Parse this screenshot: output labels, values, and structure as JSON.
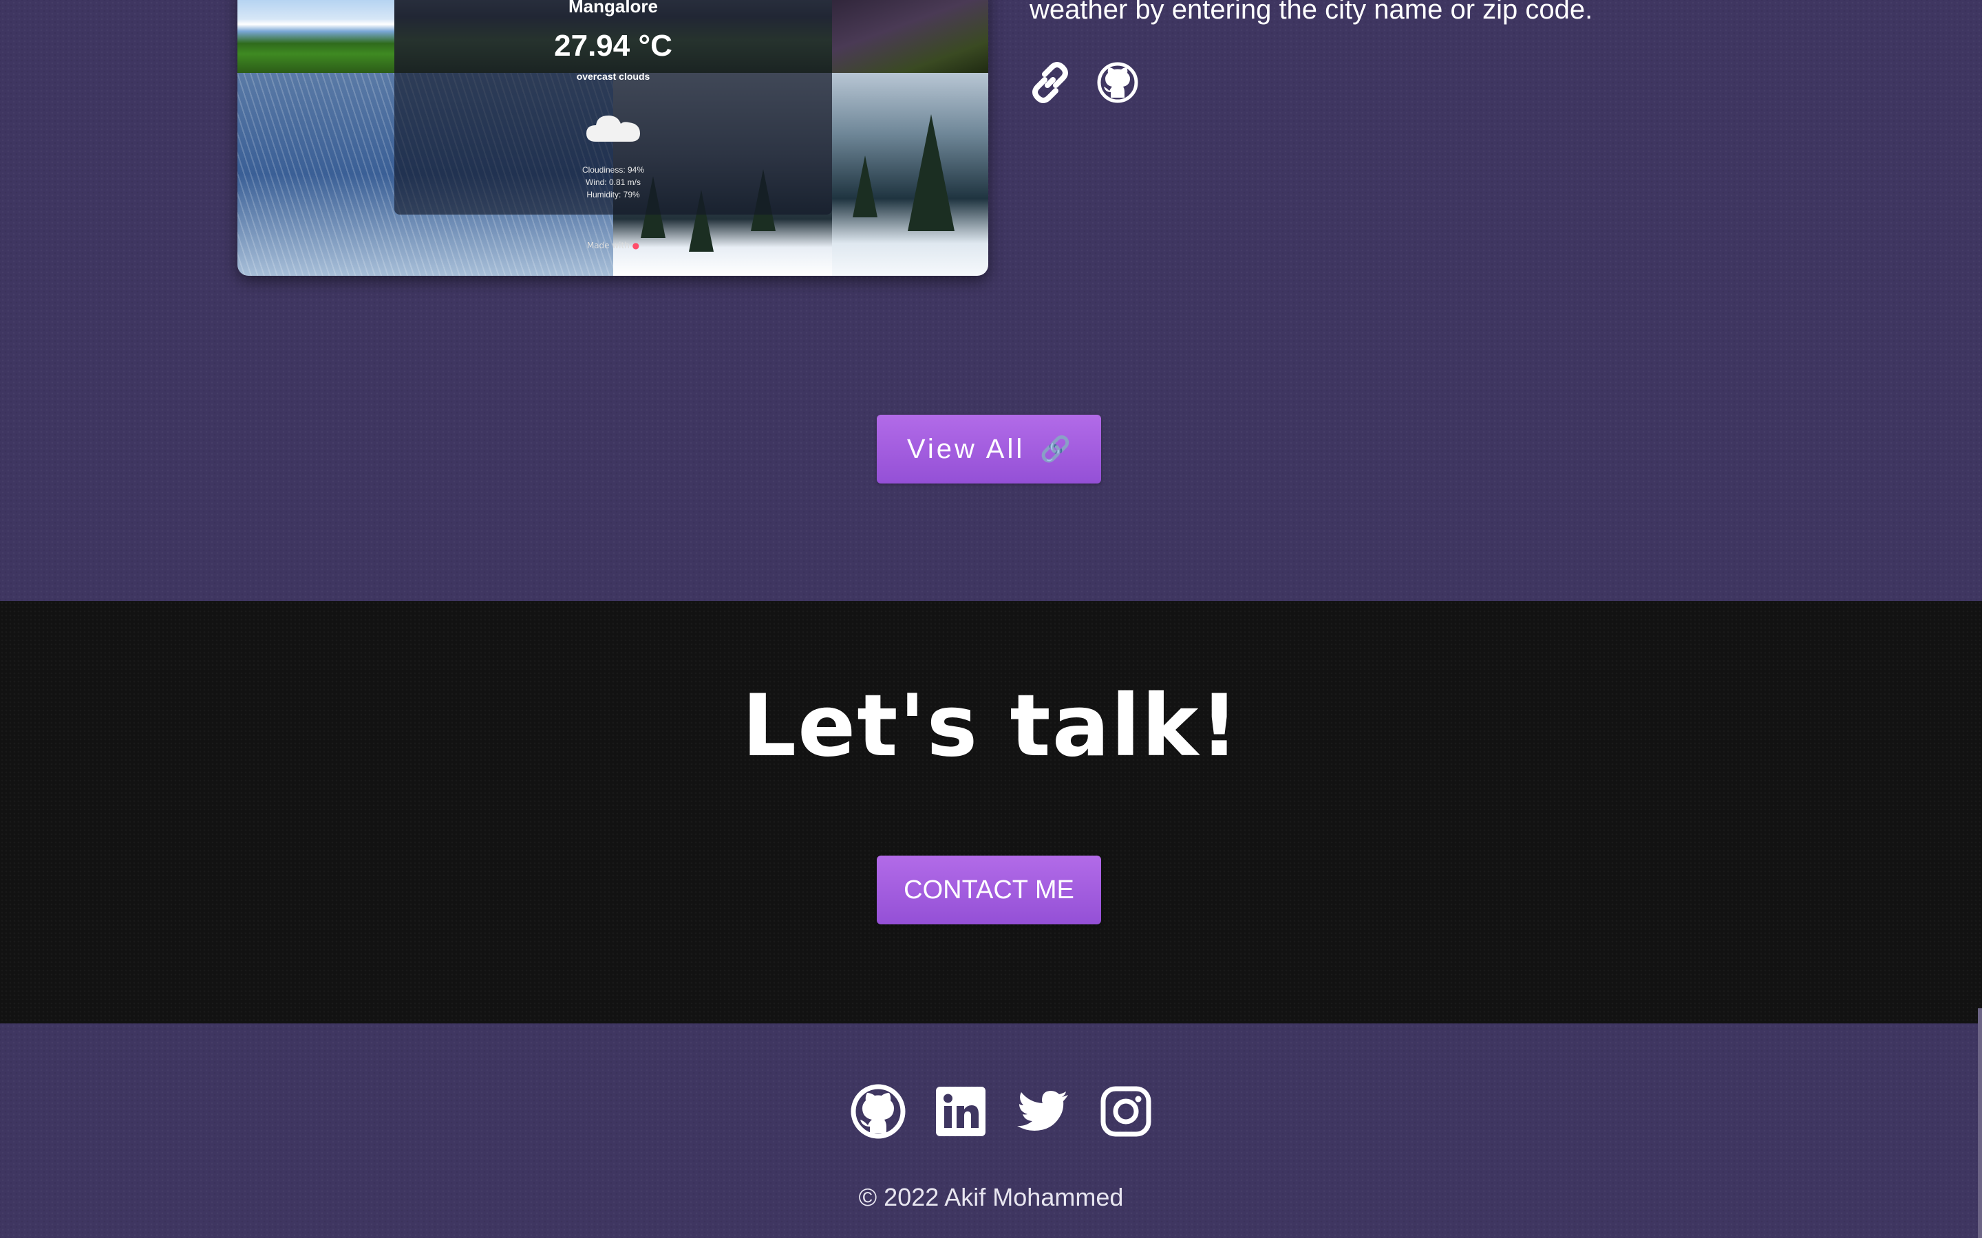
{
  "project": {
    "weather_card": {
      "city": "Mangalore",
      "temperature": "27.94 °C",
      "description": "overcast clouds",
      "icon": "cloud-icon",
      "stats": [
        "Cloudiness: 94%",
        "Wind: 0.81 m/s",
        "Humidity: 79%"
      ],
      "footer_prefix": "Made with",
      "footer_icon": "heart-icon"
    },
    "description_tail": "weather by entering the city name or zip code.",
    "links": [
      {
        "icon": "link-icon"
      },
      {
        "icon": "github-icon"
      }
    ]
  },
  "view_all": {
    "label": "View All",
    "icon": "🔗"
  },
  "contact": {
    "title": "Let's talk!",
    "button_label": "CONTACT ME"
  },
  "footer": {
    "social": [
      {
        "icon": "github-icon"
      },
      {
        "icon": "linkedin-icon"
      },
      {
        "icon": "twitter-icon"
      },
      {
        "icon": "instagram-icon"
      }
    ],
    "copyright": "© 2022 Akif Mohammed"
  },
  "colors": {
    "section_purple": "#3f3661",
    "section_dark": "#121212",
    "button_gradient_top": "#b26be8",
    "button_gradient_bottom": "#9450d6",
    "text": "#ffffff"
  }
}
